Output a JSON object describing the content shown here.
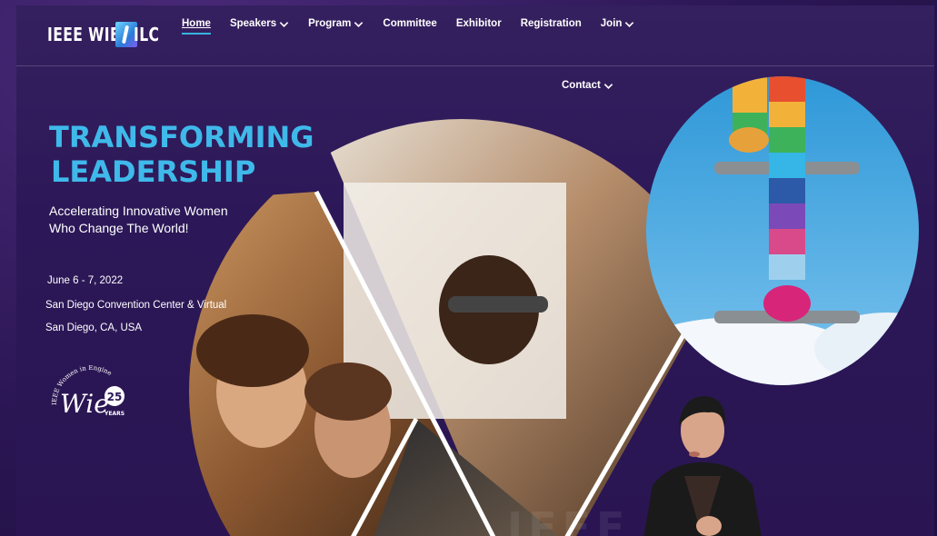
{
  "brand": {
    "logo_left": "IEEE WIE",
    "logo_right": "ILC"
  },
  "nav": {
    "home": "Home",
    "speakers": "Speakers",
    "program": "Program",
    "committee": "Committee",
    "exhibitor": "Exhibitor",
    "registration": "Registration",
    "join": "Join",
    "contact": "Contact"
  },
  "hero": {
    "title_line1": "TRANSFORMING",
    "title_line2": "LEADERSHIP",
    "subtitle_line1": "Accelerating Innovative Women",
    "subtitle_line2": "Who Change The World!"
  },
  "event": {
    "date": "June 6 - 7, 2022",
    "venue": "San Diego Convention Center & Virtual",
    "city": "San Diego, CA, USA"
  },
  "badge": {
    "arc_text": "IEEE Women in Engineering",
    "wordmark": "Wie",
    "number": "25",
    "years": "YEARS"
  },
  "colors": {
    "accent_blue": "#3fb9ea",
    "background_purple": "#2c1858",
    "nav_underline": "#36b5e0"
  },
  "icons": {
    "dropdown": "chevron-down-icon"
  }
}
